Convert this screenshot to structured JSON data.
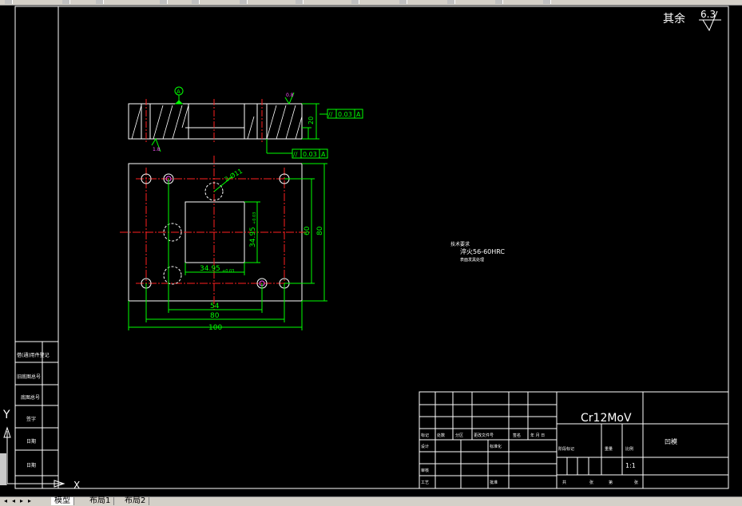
{
  "app": {
    "name": "AutoCAD drawing view"
  },
  "surface_finish": {
    "other_label": "其余",
    "value": "6.3"
  },
  "views": {
    "datum_label": "A",
    "roughness_marks": [
      "0.8",
      "1.8"
    ],
    "tolerance_frames": [
      {
        "symbol": "//",
        "value": "0.03",
        "datum": "A"
      },
      {
        "symbol": "//",
        "value": "0.03",
        "datum": "A"
      }
    ],
    "dimensions": {
      "hole_callout": "2-Ø11",
      "inner_width": "34.95",
      "inner_width_tol": "+0.03",
      "inner_height": "34.95",
      "inner_height_tol": "+0.03",
      "bottom_54": "54",
      "bottom_80": "80",
      "bottom_100": "100",
      "right_60": "60",
      "right_80": "80",
      "thickness": "20"
    }
  },
  "notes": {
    "title": "技术要求",
    "line1": "淬火56-60HRC",
    "line2": "表面发黑处理"
  },
  "title_block": {
    "material": "Cr12MoV",
    "part_name": "凹模",
    "scale": "1:1",
    "revision_headers": [
      "标记",
      "处数",
      "分区",
      "更改文件号",
      "签名",
      "年 月 日"
    ],
    "role_labels": [
      "设计",
      "审核",
      "工艺"
    ],
    "mid_labels": [
      "标准化",
      "批准"
    ],
    "stage_headers": [
      "阶段标记",
      "重量",
      "比例"
    ],
    "sheet_footer": [
      "共",
      "张",
      "第",
      "张"
    ]
  },
  "side_table": {
    "rows": [
      "借(通)用件登记",
      "旧底图总号",
      "底图总号",
      "签字",
      "日期",
      "日期"
    ]
  },
  "ucs": {
    "y_label": "Y",
    "x_label": "X"
  },
  "layout_tabs": {
    "model": "模型",
    "layout1": "布局1",
    "layout2": "布局2"
  }
}
